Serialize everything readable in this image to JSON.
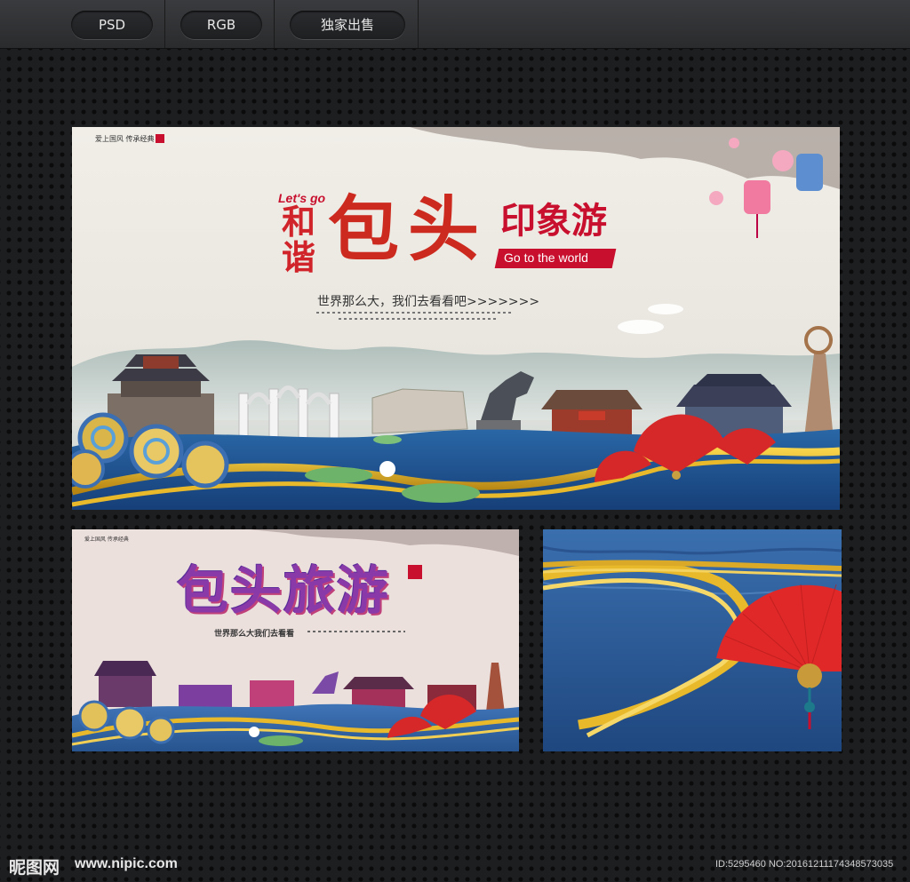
{
  "tabs": [
    "PSD",
    "RGB",
    "独家出售"
  ],
  "banner_main": {
    "corner_text": "爱上国风 传承经典",
    "lets_go": "Let's go",
    "he": "和",
    "xie": "谐",
    "bao": "包",
    "tou": "头",
    "impression": "印象游",
    "go_world": "Go to the world",
    "slogan": "世界那么大，我们去看看吧>>>>>>>"
  },
  "banner_small": {
    "corner_text": "爱上国风 传承经典",
    "title": "包头旅游",
    "slogan": "世界那么大我们去看看"
  },
  "footer": {
    "logo_text": "昵图网",
    "url": "www.nipic.com",
    "id_text": "ID:5295460 NO:20161211174348573035"
  },
  "colors": {
    "accent_red": "#c8102e",
    "gold": "#e8b92b",
    "water_blue": "#1f4f8f"
  }
}
